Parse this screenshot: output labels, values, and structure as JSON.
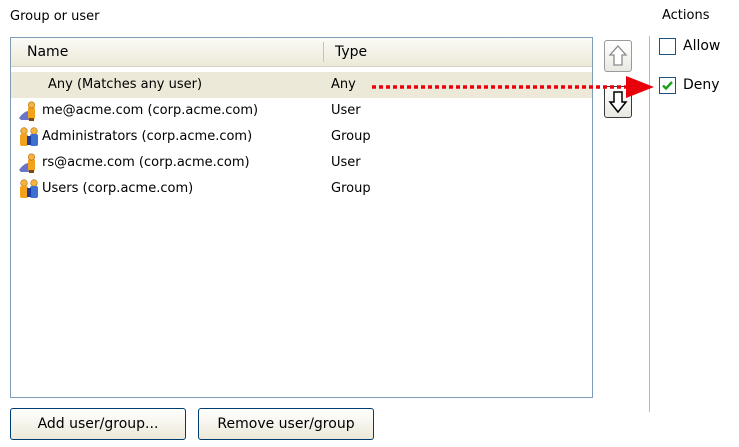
{
  "group_box": {
    "label": "Group or user"
  },
  "actions": {
    "label": "Actions",
    "allow_label": "Allow",
    "deny_label": "Deny",
    "allow_checked": false,
    "deny_checked": true
  },
  "table": {
    "columns": [
      "Name",
      "Type"
    ],
    "rows": [
      {
        "name": "Any (Matches any user)",
        "type": "Any",
        "icon": "none",
        "selected": true
      },
      {
        "name": "me@acme.com (corp.acme.com)",
        "type": "User",
        "icon": "user-icon"
      },
      {
        "name": "Administrators (corp.acme.com)",
        "type": "Group",
        "icon": "group-icon"
      },
      {
        "name": "rs@acme.com (corp.acme.com)",
        "type": "User",
        "icon": "user-icon"
      },
      {
        "name": "Users (corp.acme.com)",
        "type": "Group",
        "icon": "group-icon"
      }
    ]
  },
  "buttons": {
    "add": "Add user/group...",
    "remove": "Remove user/group"
  },
  "colors": {
    "annotation_arrow": "#e8000a",
    "selected_row": "#ece9d8",
    "border": "#7f9db9",
    "check": "#1aa31a"
  }
}
